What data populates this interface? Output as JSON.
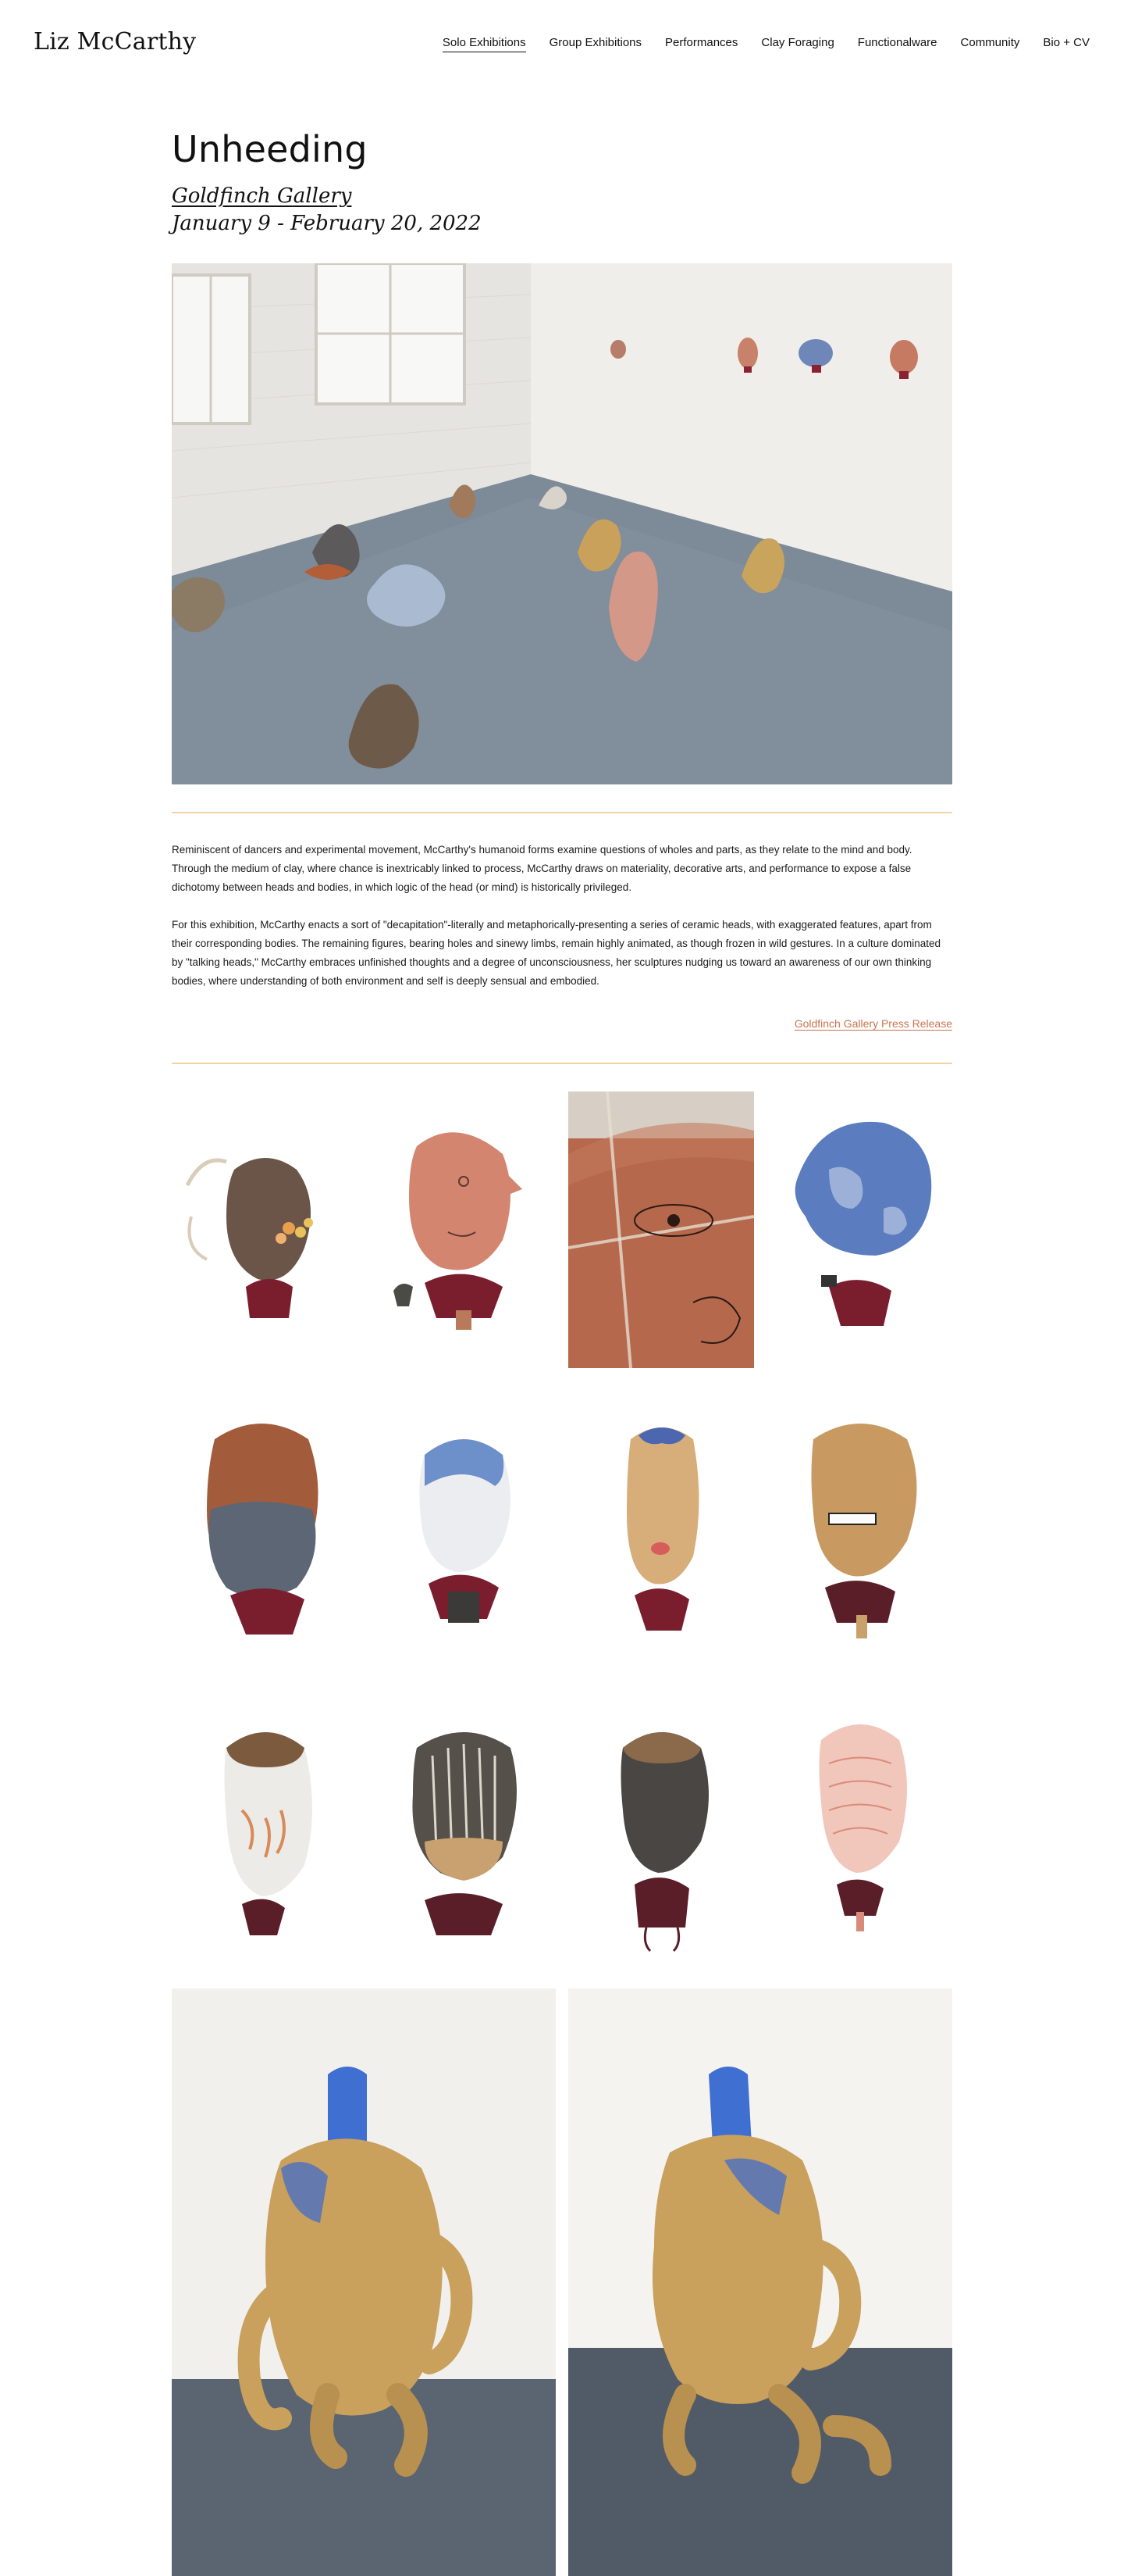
{
  "site": {
    "title": "Liz McCarthy"
  },
  "nav": {
    "items": [
      {
        "label": "Solo Exhibitions",
        "active": true
      },
      {
        "label": "Group Exhibitions",
        "active": false
      },
      {
        "label": "Performances",
        "active": false
      },
      {
        "label": "Clay Foraging",
        "active": false
      },
      {
        "label": "Functionalware",
        "active": false
      },
      {
        "label": "Community",
        "active": false
      },
      {
        "label": "Bio + CV",
        "active": false
      }
    ]
  },
  "exhibition": {
    "title": "Unheeding",
    "venue": "Goldfinch Gallery",
    "dates": "January 9 - February 20, 2022",
    "paragraphs": [
      "Reminiscent of dancers and experimental movement, McCarthy's humanoid forms examine questions of wholes and parts, as they relate to the mind and body. Through the medium of clay, where chance is inextricably linked to process, McCarthy draws on materiality, decorative arts, and performance to expose a false dichotomy between heads and bodies, in which logic of the head (or mind) is historically privileged.",
      "For this exhibition, McCarthy enacts a sort of \"decapitation\"-literally and metaphorically-presenting a series of ceramic heads, with exaggerated features, apart from their corresponding bodies. The remaining figures, bearing holes and sinewy limbs, remain highly animated, as though frozen in wild gestures. In a culture dominated by \"talking heads,\" McCarthy embraces unfinished thoughts and a degree of unconsciousness, her sculptures nudging us toward an awareness of our own thinking bodies, where understanding of both environment and self is deeply sensual and embodied."
    ],
    "press_link": "Goldfinch Gallery Press Release"
  },
  "colors": {
    "divider": "#f2d3a6",
    "link": "#c8744f",
    "floor": "#7a8794",
    "wall": "#ecebe7"
  }
}
